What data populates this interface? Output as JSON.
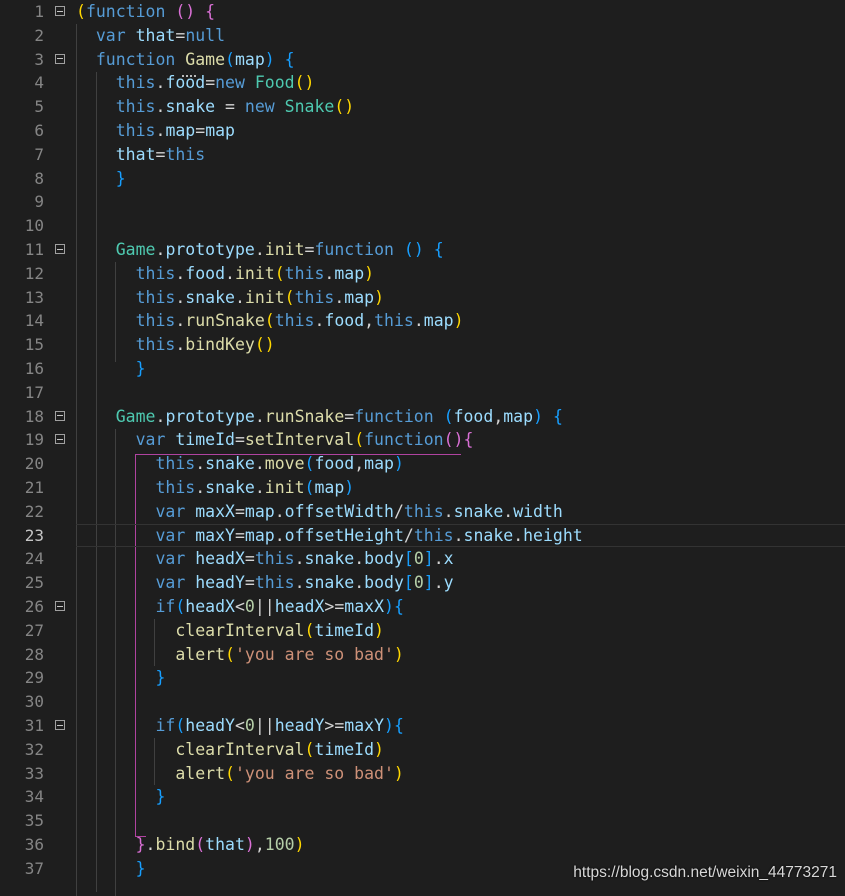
{
  "editor": {
    "active_line": 23,
    "folded_lines": [
      1,
      3,
      11,
      18,
      19,
      26,
      31
    ],
    "lines": [
      {
        "n": 1,
        "tokens": [
          [
            "(",
            "b1"
          ],
          [
            "function",
            "kw"
          ],
          [
            " ",
            "plain"
          ],
          [
            "()",
            "b2"
          ],
          [
            " ",
            "plain"
          ],
          [
            "{",
            "b2"
          ]
        ]
      },
      {
        "n": 2,
        "tokens": [
          [
            "  ",
            "plain"
          ],
          [
            "var",
            "kw"
          ],
          [
            " ",
            "plain"
          ],
          [
            "that",
            "var"
          ],
          [
            "=",
            "plain"
          ],
          [
            "null",
            "kw"
          ]
        ]
      },
      {
        "n": 3,
        "tokens": [
          [
            "  ",
            "plain"
          ],
          [
            "function",
            "kw"
          ],
          [
            " ",
            "plain"
          ],
          [
            "Game",
            "fn"
          ],
          [
            "(",
            "b3"
          ],
          [
            "map",
            "var"
          ],
          [
            ")",
            "b3"
          ],
          [
            " ",
            "plain"
          ],
          [
            "{",
            "b3"
          ]
        ]
      },
      {
        "n": 4,
        "tokens": [
          [
            "    ",
            "plain"
          ],
          [
            "this",
            "kw"
          ],
          [
            ".",
            "plain"
          ],
          [
            "food",
            "var"
          ],
          [
            "=",
            "plain"
          ],
          [
            "new",
            "kw"
          ],
          [
            " ",
            "plain"
          ],
          [
            "Food",
            "cls"
          ],
          [
            "()",
            "b1"
          ]
        ]
      },
      {
        "n": 5,
        "tokens": [
          [
            "    ",
            "plain"
          ],
          [
            "this",
            "kw"
          ],
          [
            ".",
            "plain"
          ],
          [
            "snake",
            "var"
          ],
          [
            " = ",
            "plain"
          ],
          [
            "new",
            "kw"
          ],
          [
            " ",
            "plain"
          ],
          [
            "Snake",
            "cls"
          ],
          [
            "()",
            "b1"
          ]
        ]
      },
      {
        "n": 6,
        "tokens": [
          [
            "    ",
            "plain"
          ],
          [
            "this",
            "kw"
          ],
          [
            ".",
            "plain"
          ],
          [
            "map",
            "var"
          ],
          [
            "=",
            "plain"
          ],
          [
            "map",
            "var"
          ]
        ]
      },
      {
        "n": 7,
        "tokens": [
          [
            "    ",
            "plain"
          ],
          [
            "that",
            "var"
          ],
          [
            "=",
            "plain"
          ],
          [
            "this",
            "kw"
          ]
        ]
      },
      {
        "n": 8,
        "tokens": [
          [
            "    ",
            "plain"
          ],
          [
            "}",
            "b3"
          ]
        ]
      },
      {
        "n": 9,
        "tokens": []
      },
      {
        "n": 10,
        "tokens": []
      },
      {
        "n": 11,
        "tokens": [
          [
            "    ",
            "plain"
          ],
          [
            "Game",
            "cls"
          ],
          [
            ".",
            "plain"
          ],
          [
            "prototype",
            "var"
          ],
          [
            ".",
            "plain"
          ],
          [
            "init",
            "fn"
          ],
          [
            "=",
            "plain"
          ],
          [
            "function",
            "kw"
          ],
          [
            " ",
            "plain"
          ],
          [
            "()",
            "b3"
          ],
          [
            " ",
            "plain"
          ],
          [
            "{",
            "b3"
          ]
        ]
      },
      {
        "n": 12,
        "tokens": [
          [
            "      ",
            "plain"
          ],
          [
            "this",
            "kw"
          ],
          [
            ".",
            "plain"
          ],
          [
            "food",
            "var"
          ],
          [
            ".",
            "plain"
          ],
          [
            "init",
            "fn"
          ],
          [
            "(",
            "b1"
          ],
          [
            "this",
            "kw"
          ],
          [
            ".",
            "plain"
          ],
          [
            "map",
            "var"
          ],
          [
            ")",
            "b1"
          ]
        ]
      },
      {
        "n": 13,
        "tokens": [
          [
            "      ",
            "plain"
          ],
          [
            "this",
            "kw"
          ],
          [
            ".",
            "plain"
          ],
          [
            "snake",
            "var"
          ],
          [
            ".",
            "plain"
          ],
          [
            "init",
            "fn"
          ],
          [
            "(",
            "b1"
          ],
          [
            "this",
            "kw"
          ],
          [
            ".",
            "plain"
          ],
          [
            "map",
            "var"
          ],
          [
            ")",
            "b1"
          ]
        ]
      },
      {
        "n": 14,
        "tokens": [
          [
            "      ",
            "plain"
          ],
          [
            "this",
            "kw"
          ],
          [
            ".",
            "plain"
          ],
          [
            "runSnake",
            "fn"
          ],
          [
            "(",
            "b1"
          ],
          [
            "this",
            "kw"
          ],
          [
            ".",
            "plain"
          ],
          [
            "food",
            "var"
          ],
          [
            ",",
            "plain"
          ],
          [
            "this",
            "kw"
          ],
          [
            ".",
            "plain"
          ],
          [
            "map",
            "var"
          ],
          [
            ")",
            "b1"
          ]
        ]
      },
      {
        "n": 15,
        "tokens": [
          [
            "      ",
            "plain"
          ],
          [
            "this",
            "kw"
          ],
          [
            ".",
            "plain"
          ],
          [
            "bindKey",
            "fn"
          ],
          [
            "()",
            "b1"
          ]
        ]
      },
      {
        "n": 16,
        "tokens": [
          [
            "      ",
            "plain"
          ],
          [
            "}",
            "b3"
          ]
        ]
      },
      {
        "n": 17,
        "tokens": []
      },
      {
        "n": 18,
        "tokens": [
          [
            "    ",
            "plain"
          ],
          [
            "Game",
            "cls"
          ],
          [
            ".",
            "plain"
          ],
          [
            "prototype",
            "var"
          ],
          [
            ".",
            "plain"
          ],
          [
            "runSnake",
            "fn"
          ],
          [
            "=",
            "plain"
          ],
          [
            "function",
            "kw"
          ],
          [
            " ",
            "plain"
          ],
          [
            "(",
            "b3"
          ],
          [
            "food",
            "var"
          ],
          [
            ",",
            "plain"
          ],
          [
            "map",
            "var"
          ],
          [
            ")",
            "b3"
          ],
          [
            " ",
            "plain"
          ],
          [
            "{",
            "b3"
          ]
        ]
      },
      {
        "n": 19,
        "tokens": [
          [
            "      ",
            "plain"
          ],
          [
            "var",
            "kw"
          ],
          [
            " ",
            "plain"
          ],
          [
            "timeId",
            "var"
          ],
          [
            "=",
            "plain"
          ],
          [
            "setInterval",
            "fn"
          ],
          [
            "(",
            "b1"
          ],
          [
            "function",
            "kw"
          ],
          [
            "()",
            "b2"
          ],
          [
            "{",
            "b2"
          ]
        ]
      },
      {
        "n": 20,
        "tokens": [
          [
            "        ",
            "plain"
          ],
          [
            "this",
            "kw"
          ],
          [
            ".",
            "plain"
          ],
          [
            "snake",
            "var"
          ],
          [
            ".",
            "plain"
          ],
          [
            "move",
            "fn"
          ],
          [
            "(",
            "b3"
          ],
          [
            "food",
            "var"
          ],
          [
            ",",
            "plain"
          ],
          [
            "map",
            "var"
          ],
          [
            ")",
            "b3"
          ]
        ]
      },
      {
        "n": 21,
        "tokens": [
          [
            "        ",
            "plain"
          ],
          [
            "this",
            "kw"
          ],
          [
            ".",
            "plain"
          ],
          [
            "snake",
            "var"
          ],
          [
            ".",
            "plain"
          ],
          [
            "init",
            "fn"
          ],
          [
            "(",
            "b3"
          ],
          [
            "map",
            "var"
          ],
          [
            ")",
            "b3"
          ]
        ]
      },
      {
        "n": 22,
        "tokens": [
          [
            "        ",
            "plain"
          ],
          [
            "var",
            "kw"
          ],
          [
            " ",
            "plain"
          ],
          [
            "maxX",
            "var"
          ],
          [
            "=",
            "plain"
          ],
          [
            "map",
            "var"
          ],
          [
            ".",
            "plain"
          ],
          [
            "offsetWidth",
            "var"
          ],
          [
            "/",
            "plain"
          ],
          [
            "this",
            "kw"
          ],
          [
            ".",
            "plain"
          ],
          [
            "snake",
            "var"
          ],
          [
            ".",
            "plain"
          ],
          [
            "width",
            "var"
          ]
        ]
      },
      {
        "n": 23,
        "tokens": [
          [
            "        ",
            "plain"
          ],
          [
            "var",
            "kw"
          ],
          [
            " ",
            "plain"
          ],
          [
            "maxY",
            "var"
          ],
          [
            "=",
            "plain"
          ],
          [
            "map",
            "var"
          ],
          [
            ".",
            "plain"
          ],
          [
            "offsetHeight",
            "var"
          ],
          [
            "/",
            "plain"
          ],
          [
            "this",
            "kw"
          ],
          [
            ".",
            "plain"
          ],
          [
            "snake",
            "var"
          ],
          [
            ".",
            "plain"
          ],
          [
            "height",
            "var"
          ]
        ]
      },
      {
        "n": 24,
        "tokens": [
          [
            "        ",
            "plain"
          ],
          [
            "var",
            "kw"
          ],
          [
            " ",
            "plain"
          ],
          [
            "headX",
            "var"
          ],
          [
            "=",
            "plain"
          ],
          [
            "this",
            "kw"
          ],
          [
            ".",
            "plain"
          ],
          [
            "snake",
            "var"
          ],
          [
            ".",
            "plain"
          ],
          [
            "body",
            "var"
          ],
          [
            "[",
            "b3"
          ],
          [
            "0",
            "num"
          ],
          [
            "]",
            "b3"
          ],
          [
            ".",
            "plain"
          ],
          [
            "x",
            "var"
          ]
        ]
      },
      {
        "n": 25,
        "tokens": [
          [
            "        ",
            "plain"
          ],
          [
            "var",
            "kw"
          ],
          [
            " ",
            "plain"
          ],
          [
            "headY",
            "var"
          ],
          [
            "=",
            "plain"
          ],
          [
            "this",
            "kw"
          ],
          [
            ".",
            "plain"
          ],
          [
            "snake",
            "var"
          ],
          [
            ".",
            "plain"
          ],
          [
            "body",
            "var"
          ],
          [
            "[",
            "b3"
          ],
          [
            "0",
            "num"
          ],
          [
            "]",
            "b3"
          ],
          [
            ".",
            "plain"
          ],
          [
            "y",
            "var"
          ]
        ]
      },
      {
        "n": 26,
        "tokens": [
          [
            "        ",
            "plain"
          ],
          [
            "if",
            "kw"
          ],
          [
            "(",
            "b3"
          ],
          [
            "headX",
            "var"
          ],
          [
            "<",
            "plain"
          ],
          [
            "0",
            "num"
          ],
          [
            "||",
            "plain"
          ],
          [
            "headX",
            "var"
          ],
          [
            ">=",
            "plain"
          ],
          [
            "maxX",
            "var"
          ],
          [
            ")",
            "b3"
          ],
          [
            "{",
            "b3"
          ]
        ]
      },
      {
        "n": 27,
        "tokens": [
          [
            "          ",
            "plain"
          ],
          [
            "clearInterval",
            "fn"
          ],
          [
            "(",
            "b1"
          ],
          [
            "timeId",
            "var"
          ],
          [
            ")",
            "b1"
          ]
        ]
      },
      {
        "n": 28,
        "tokens": [
          [
            "          ",
            "plain"
          ],
          [
            "alert",
            "fn"
          ],
          [
            "(",
            "b1"
          ],
          [
            "'you are so bad'",
            "str"
          ],
          [
            ")",
            "b1"
          ]
        ]
      },
      {
        "n": 29,
        "tokens": [
          [
            "        ",
            "plain"
          ],
          [
            "}",
            "b3"
          ]
        ]
      },
      {
        "n": 30,
        "tokens": []
      },
      {
        "n": 31,
        "tokens": [
          [
            "        ",
            "plain"
          ],
          [
            "if",
            "kw"
          ],
          [
            "(",
            "b3"
          ],
          [
            "headY",
            "var"
          ],
          [
            "<",
            "plain"
          ],
          [
            "0",
            "num"
          ],
          [
            "||",
            "plain"
          ],
          [
            "headY",
            "var"
          ],
          [
            ">=",
            "plain"
          ],
          [
            "maxY",
            "var"
          ],
          [
            ")",
            "b3"
          ],
          [
            "{",
            "b3"
          ]
        ]
      },
      {
        "n": 32,
        "tokens": [
          [
            "          ",
            "plain"
          ],
          [
            "clearInterval",
            "fn"
          ],
          [
            "(",
            "b1"
          ],
          [
            "timeId",
            "var"
          ],
          [
            ")",
            "b1"
          ]
        ]
      },
      {
        "n": 33,
        "tokens": [
          [
            "          ",
            "plain"
          ],
          [
            "alert",
            "fn"
          ],
          [
            "(",
            "b1"
          ],
          [
            "'you are so bad'",
            "str"
          ],
          [
            ")",
            "b1"
          ]
        ]
      },
      {
        "n": 34,
        "tokens": [
          [
            "        ",
            "plain"
          ],
          [
            "}",
            "b3"
          ]
        ]
      },
      {
        "n": 35,
        "tokens": []
      },
      {
        "n": 36,
        "tokens": [
          [
            "      ",
            "plain"
          ],
          [
            "}",
            "b2"
          ],
          [
            ".",
            "plain"
          ],
          [
            "bind",
            "fn"
          ],
          [
            "(",
            "b2"
          ],
          [
            "that",
            "var"
          ],
          [
            ")",
            "b2"
          ],
          [
            ",",
            "plain"
          ],
          [
            "100",
            "num"
          ],
          [
            ")",
            "b1"
          ]
        ]
      },
      {
        "n": 37,
        "tokens": [
          [
            "      ",
            "plain"
          ],
          [
            "}",
            "b3"
          ]
        ]
      }
    ]
  },
  "watermark": "https://blog.csdn.net/weixin_44773271"
}
